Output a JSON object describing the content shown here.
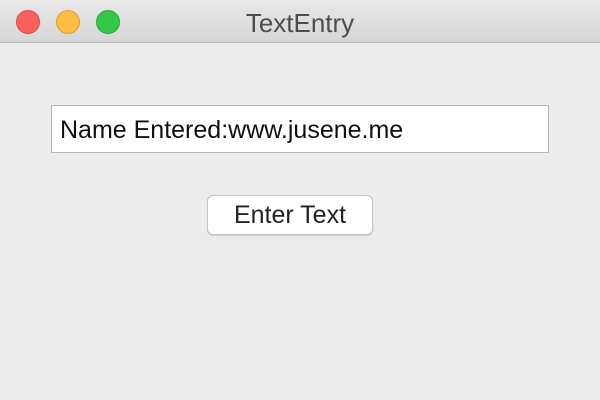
{
  "window": {
    "title": "TextEntry",
    "controls": {
      "close_color": "#fc605c",
      "minimize_color": "#fdbc40",
      "zoom_color": "#34c84a"
    }
  },
  "main": {
    "text_field": {
      "value": "Name Entered:www.jusene.me"
    },
    "enter_button": {
      "label": "Enter Text"
    }
  }
}
